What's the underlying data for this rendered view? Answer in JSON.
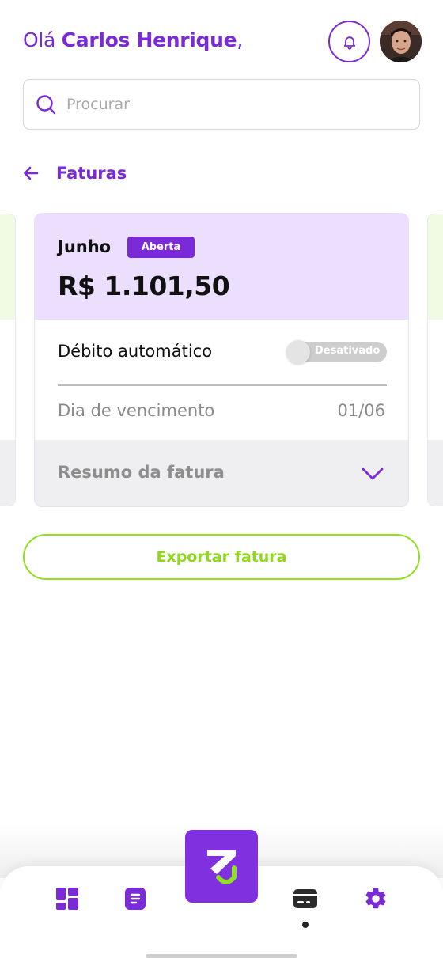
{
  "header": {
    "greeting_prefix": "Olá",
    "user_name": "Carlos Henrique",
    "greeting_suffix": ",",
    "icons": {
      "notifications": "bell-icon",
      "profile": "avatar"
    }
  },
  "search": {
    "placeholder": "Procurar",
    "value": "",
    "icon": "search-icon"
  },
  "page": {
    "back_icon": "arrow-left-icon",
    "title": "Faturas"
  },
  "invoice": {
    "month": "Junho",
    "status": "Aberta",
    "amount": "R$ 1.101,50",
    "autodebit_label": "Débito automático",
    "autodebit_state": "Desativado",
    "autodebit_enabled": false,
    "due_label": "Dia de vencimento",
    "due_value": "01/06",
    "summary_label": "Resumo da fatura"
  },
  "actions": {
    "export_label": "Exportar fatura"
  },
  "nav": {
    "items": [
      "dashboard-icon",
      "document-icon",
      "logo",
      "credit-card-icon",
      "gear-icon"
    ],
    "active": "credit-card-icon"
  },
  "colors": {
    "primary": "#7a2ad6",
    "accent_green": "#8fe01e",
    "card_header": "#ecdffe",
    "summary_bg": "#efeef0"
  }
}
